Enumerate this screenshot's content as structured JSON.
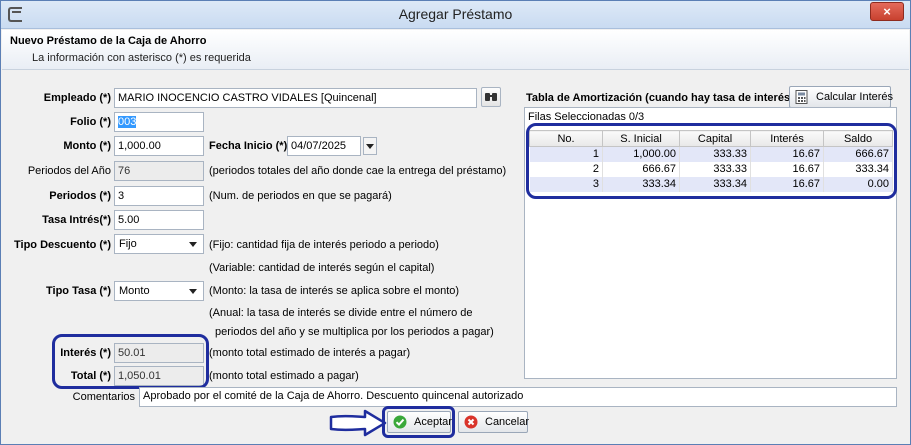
{
  "window": {
    "title": "Agregar Préstamo",
    "close_glyph": "×"
  },
  "header": {
    "title": "Nuevo Préstamo de la Caja de Ahorro",
    "subtitle": "La información con asterisco (*) es requerida"
  },
  "form": {
    "empleado": {
      "label": "Empleado (*)",
      "value": "MARIO INOCENCIO CASTRO VIDALES [Quincenal]"
    },
    "folio": {
      "label": "Folio (*)",
      "value": "003"
    },
    "monto": {
      "label": "Monto (*)",
      "value": "1,000.00"
    },
    "fecha_inicio": {
      "label": "Fecha Inicio (*)",
      "value": "04/07/2025"
    },
    "periodos_anio": {
      "label": "Periodos del Año",
      "value": "76",
      "hint": "(periodos totales del año donde cae la entrega del préstamo)"
    },
    "periodos": {
      "label": "Periodos (*)",
      "value": "3",
      "hint": "(Num. de periodos en que se pagará)"
    },
    "tasa_interes": {
      "label": "Tasa Intrés(*)",
      "value": "5.00"
    },
    "tipo_descuento": {
      "label": "Tipo Descuento (*)",
      "value": "Fijo",
      "hint1": "(Fijo: cantidad fija de interés periodo a periodo)",
      "hint2": "(Variable: cantidad de interés según el capital)"
    },
    "tipo_tasa": {
      "label": "Tipo Tasa (*)",
      "value": "Monto",
      "hint1": "(Monto: la tasa de interés se aplica sobre el monto)",
      "hint2": "(Anual: la tasa de interés se divide entre el número de",
      "hint3": "periodos del año y se multiplica por los periodos a pagar)"
    },
    "interes": {
      "label": "Interés (*)",
      "value": "50.01",
      "hint": "(monto total estimado de interés a pagar)"
    },
    "total": {
      "label": "Total (*)",
      "value": "1,050.01",
      "hint": "(monto total estimado a pagar)"
    },
    "comentarios": {
      "label": "Comentarios",
      "value": "Aprobado por el comité de la Caja de Ahorro. Descuento quincenal autorizado"
    }
  },
  "amortization": {
    "title": "Tabla de Amortización (cuando hay tasa de interés)",
    "calc_button": "Calcular Interés",
    "selected_rows": "Filas Seleccionadas  0/3",
    "columns": [
      "No.",
      "S. Inicial",
      "Capital",
      "Interés",
      "Saldo"
    ],
    "rows": [
      [
        "1",
        "1,000.00",
        "333.33",
        "16.67",
        "666.67"
      ],
      [
        "2",
        "666.67",
        "333.33",
        "16.67",
        "333.34"
      ],
      [
        "3",
        "333.34",
        "333.34",
        "16.67",
        "0.00"
      ]
    ]
  },
  "buttons": {
    "accept": "Aceptar",
    "cancel": "Cancelar"
  },
  "colors": {
    "highlight": "#1f2d9e",
    "title_bar": "#c9dbf1",
    "close_button": "#c8412f",
    "row_alt": "#e3e7f8"
  }
}
